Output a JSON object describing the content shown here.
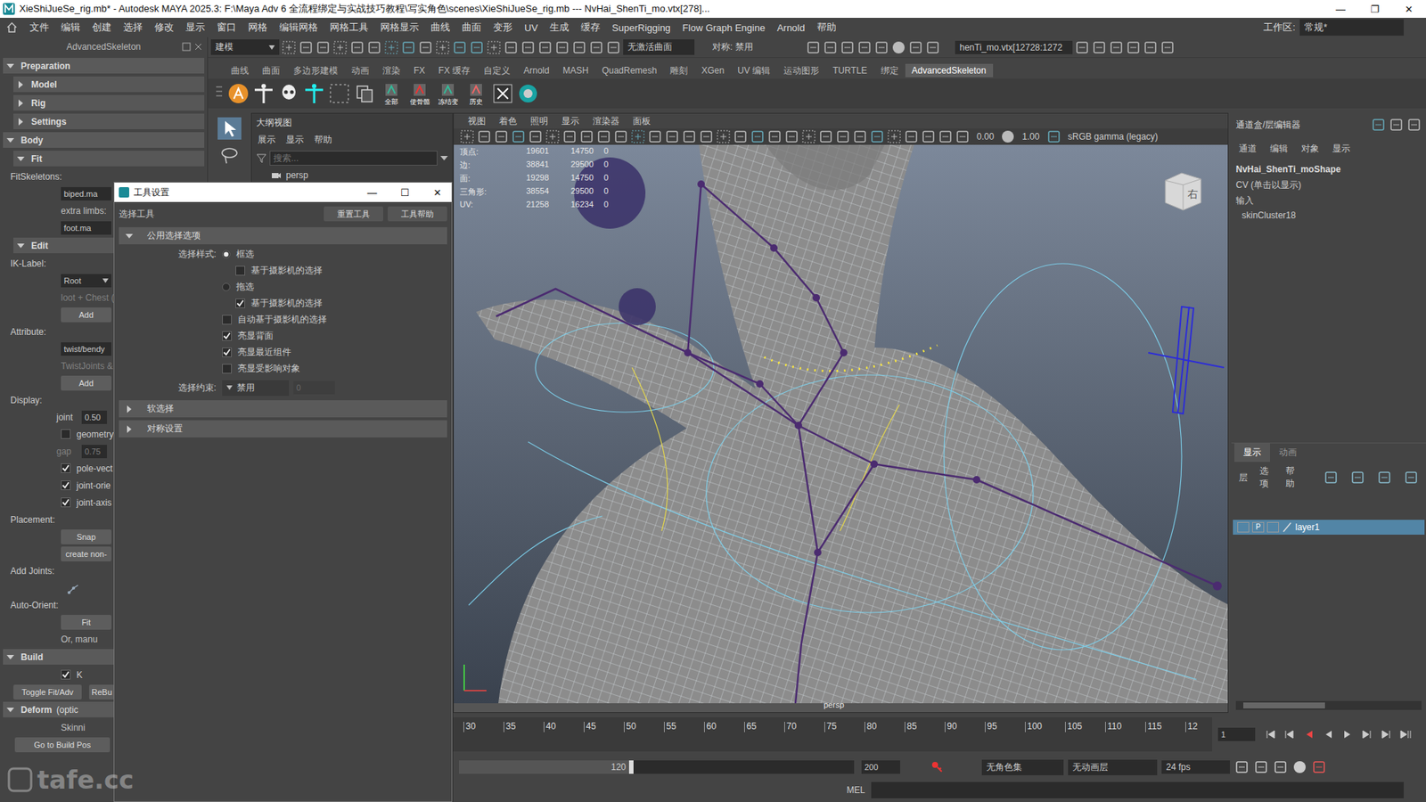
{
  "window": {
    "title": "XieShiJueSe_rig.mb* - Autodesk MAYA 2025.3: F:\\Maya Adv 6 全流程绑定与实战技巧教程\\写实角色\\scenes\\XieShiJueSe_rig.mb  ---  NvHai_ShenTi_mo.vtx[278]...",
    "controls": [
      "—",
      "❐",
      "✕"
    ]
  },
  "menubar": {
    "items": [
      "文件",
      "编辑",
      "创建",
      "选择",
      "修改",
      "显示",
      "窗口",
      "网格",
      "编辑网格",
      "网格工具",
      "网格显示",
      "曲线",
      "曲面",
      "变形",
      "UV",
      "生成",
      "缓存",
      "SuperRigging",
      "Flow Graph Engine",
      "Arnold",
      "帮助"
    ],
    "workspace_label": "工作区:",
    "workspace": "常规*"
  },
  "status_line": {
    "mode": "建模",
    "surface": "无激活曲面",
    "symmetry": "对称: 禁用",
    "selection": "henTi_mo.vtx[12728:1272"
  },
  "shelf": {
    "tabs": [
      {
        "label": "曲线",
        "selected": false
      },
      {
        "label": "曲面",
        "selected": false
      },
      {
        "label": "多边形建模",
        "selected": false
      },
      {
        "label": "动画",
        "selected": false
      },
      {
        "label": "渲染",
        "selected": false
      },
      {
        "label": "FX",
        "selected": false
      },
      {
        "label": "FX 缓存",
        "selected": false
      },
      {
        "label": "自定义",
        "selected": false
      },
      {
        "label": "Arnold",
        "selected": false
      },
      {
        "label": "MASH",
        "selected": false
      },
      {
        "label": "QuadRemesh",
        "selected": false
      },
      {
        "label": "雕刻",
        "selected": false
      },
      {
        "label": "XGen",
        "selected": false
      },
      {
        "label": "UV 编辑",
        "selected": false
      },
      {
        "label": "运动图形",
        "selected": false
      },
      {
        "label": "TURTLE",
        "selected": false
      },
      {
        "label": "绑定",
        "selected": false
      },
      {
        "label": "AdvancedSkeleton",
        "selected": true
      }
    ],
    "labeled_buttons": [
      "全部",
      "使骨骼",
      "冻结变",
      "历史"
    ]
  },
  "advanced_skeleton": {
    "title": "AdvancedSkeleton",
    "rows": [
      {
        "kind": "section",
        "label": "Preparation",
        "expanded": true
      },
      {
        "kind": "item",
        "label": "Model",
        "expanded": false
      },
      {
        "kind": "item",
        "label": "Rig",
        "expanded": false
      },
      {
        "kind": "item",
        "label": "Settings",
        "expanded": false
      },
      {
        "kind": "section",
        "label": "Body",
        "expanded": true
      },
      {
        "kind": "item",
        "label": "Fit",
        "expanded": true
      },
      {
        "kind": "label",
        "label": "FitSkeletons:"
      },
      {
        "kind": "field",
        "label": "biped.ma"
      },
      {
        "kind": "note",
        "label": "extra limbs:",
        "disabled": false
      },
      {
        "kind": "field",
        "label": "foot.ma"
      },
      {
        "kind": "item",
        "label": "Edit",
        "expanded": true
      },
      {
        "kind": "label",
        "label": "IK-Label:"
      },
      {
        "kind": "dropdown",
        "label": "Root"
      },
      {
        "kind": "note",
        "label": "loot + Chest (",
        "disabled": true
      },
      {
        "kind": "button",
        "label": "Add"
      },
      {
        "kind": "label",
        "label": "Attribute:"
      },
      {
        "kind": "field",
        "label": "twist/bendy"
      },
      {
        "kind": "note",
        "label": "TwistJoints &",
        "disabled": true
      },
      {
        "kind": "button",
        "label": "Add"
      },
      {
        "kind": "label",
        "label": "Display:"
      },
      {
        "kind": "value",
        "label": "joint",
        "value": "0.50",
        "disabled": false
      },
      {
        "kind": "checkbox",
        "label": "geometry",
        "checked": false
      },
      {
        "kind": "value",
        "label": "gap",
        "value": "0.75",
        "disabled": true
      },
      {
        "kind": "checkbox",
        "label": "pole-vect",
        "checked": true
      },
      {
        "kind": "checkbox",
        "label": "joint-orie",
        "checked": true
      },
      {
        "kind": "checkbox",
        "label": "joint-axis",
        "checked": true
      },
      {
        "kind": "label",
        "label": "Placement:"
      },
      {
        "kind": "button",
        "label": "Snap"
      },
      {
        "kind": "button",
        "label": "create non-"
      },
      {
        "kind": "label",
        "label": "Add Joints:"
      },
      {
        "kind": "icon"
      },
      {
        "kind": "label",
        "label": "Auto-Orient:"
      },
      {
        "kind": "button",
        "label": "Fit"
      },
      {
        "kind": "note",
        "label": "Or, manu",
        "disabled": false
      },
      {
        "kind": "section",
        "label": "Build",
        "expanded": true
      },
      {
        "kind": "checkbox",
        "label": "K",
        "checked": true
      },
      {
        "kind": "button-pair",
        "labels": [
          "Toggle Fit/Adv",
          "ReBu"
        ]
      },
      {
        "kind": "section",
        "label": "Deform",
        "extra": "(optic",
        "expanded": true
      },
      {
        "kind": "note",
        "label": "Skinni",
        "disabled": false
      },
      {
        "kind": "wide-button",
        "label": "Go to Build Pos"
      }
    ]
  },
  "outliner": {
    "title": "大纲视图",
    "menu": [
      "展示",
      "显示",
      "帮助"
    ],
    "search_placeholder": "搜索...",
    "items": [
      "persp"
    ]
  },
  "tool_settings": {
    "title": "工具设置",
    "controls": [
      "—",
      "☐",
      "✕"
    ],
    "tool": "选择工具",
    "buttons": [
      "重置工具",
      "工具帮助"
    ],
    "section": {
      "label": "公用选择选项",
      "expanded": true
    },
    "style_label": "选择样式:",
    "options": [
      {
        "kind": "radio",
        "label": "框选",
        "selected": true
      },
      {
        "kind": "sub-checkbox",
        "label": "基于摄影机的选择",
        "checked": false
      },
      {
        "kind": "radio",
        "label": "拖选",
        "selected": false
      },
      {
        "kind": "sub-checkbox",
        "label": "基于摄影机的选择",
        "checked": true
      },
      {
        "kind": "checkbox",
        "label": "自动基于摄影机的选择",
        "checked": false
      },
      {
        "kind": "checkbox",
        "label": "亮显背面",
        "checked": true
      },
      {
        "kind": "checkbox",
        "label": "亮显最近组件",
        "checked": true
      },
      {
        "kind": "checkbox",
        "label": "亮显受影响对象",
        "checked": false
      }
    ],
    "constraint": {
      "label": "选择约束:",
      "value": "禁用",
      "field": "0",
      "field_disabled": true
    },
    "collapsed": [
      {
        "label": "软选择",
        "expanded": false
      },
      {
        "label": "对称设置",
        "expanded": false
      }
    ]
  },
  "viewport": {
    "menu": [
      "视图",
      "着色",
      "照明",
      "显示",
      "渲染器",
      "面板"
    ],
    "exposure": "0.00",
    "gamma": "1.00",
    "color_space": "sRGB gamma (legacy)",
    "hud": [
      {
        "label": "顶点:",
        "values": [
          "19601",
          "14750",
          "0"
        ]
      },
      {
        "label": "边:",
        "values": [
          "38841",
          "29500",
          "0"
        ]
      },
      {
        "label": "面:",
        "values": [
          "19298",
          "14750",
          "0"
        ]
      },
      {
        "label": "三角形:",
        "values": [
          "38554",
          "29500",
          "0"
        ]
      },
      {
        "label": "UV:",
        "values": [
          "21258",
          "16234",
          "0"
        ]
      }
    ],
    "camera": "persp",
    "viewcube": "右"
  },
  "channel_box": {
    "title": "通道盒/层编辑器",
    "menu": [
      "通道",
      "编辑",
      "对象",
      "显示"
    ],
    "object": "NvHai_ShenTi_moShape",
    "lines": [
      "CV (单击以显示)",
      "输入",
      "skinCluster18"
    ]
  },
  "layer_editor": {
    "tabs": [
      {
        "label": "显示",
        "selected": true
      },
      {
        "label": "动画",
        "selected": false
      }
    ],
    "menu": [
      "层",
      "选项",
      "帮助"
    ],
    "layers": [
      {
        "name": "layer1",
        "playback": "P",
        "selected": true
      }
    ]
  },
  "timeline": {
    "ticks": [
      "30",
      "35",
      "40",
      "45",
      "50",
      "55",
      "60",
      "65",
      "70",
      "75",
      "80",
      "85",
      "90",
      "95",
      "100",
      "105",
      "110",
      "115",
      "12"
    ],
    "current_frame": "1"
  },
  "range_slider": {
    "inner_end": "120",
    "end": "200",
    "level": 0.43
  },
  "playback": {
    "character_set": "无角色集",
    "anim_layer": "无动画层",
    "fps": "24 fps"
  },
  "command_line": {
    "language": "MEL"
  },
  "watermark": "tafe.cc"
}
